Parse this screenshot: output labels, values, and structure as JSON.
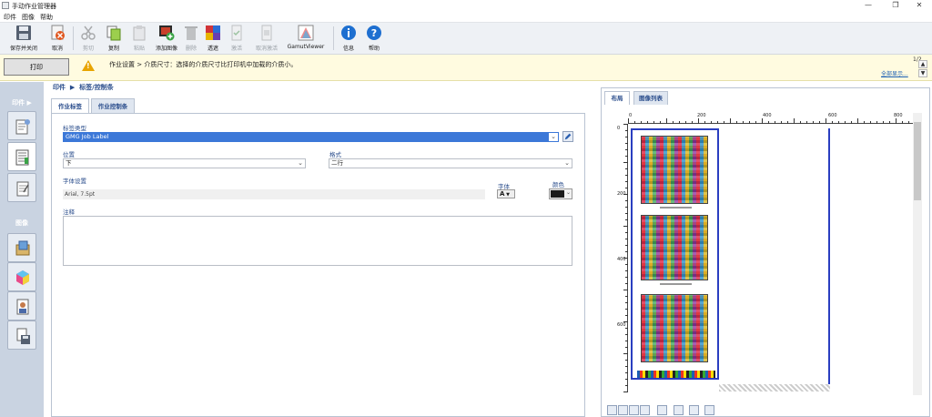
{
  "window": {
    "title": "手动作业管理器",
    "controls": [
      "—",
      "❐",
      "✕"
    ]
  },
  "menu": [
    "印件",
    "图像",
    "帮助"
  ],
  "toolbar": {
    "items": [
      {
        "label": "保存并关闭",
        "icon": "save-icon",
        "disabled": false
      },
      {
        "label": "取消",
        "icon": "cancel-icon",
        "disabled": false
      },
      {
        "label": "剪切",
        "icon": "cut-icon",
        "disabled": true
      },
      {
        "label": "复制",
        "icon": "copy-icon",
        "disabled": false
      },
      {
        "label": "粘贴",
        "icon": "paste-icon",
        "disabled": true
      },
      {
        "label": "添加图像",
        "icon": "add-image-icon",
        "disabled": false
      },
      {
        "label": "删除",
        "icon": "delete-icon",
        "disabled": true
      },
      {
        "label": "透遮",
        "icon": "overlay-icon",
        "disabled": false
      },
      {
        "label": "激活",
        "icon": "activate-icon",
        "disabled": true
      },
      {
        "label": "取消激活",
        "icon": "deactivate-icon",
        "disabled": true
      },
      {
        "label": "GamutViewer",
        "icon": "gamut-viewer-icon",
        "disabled": false
      },
      {
        "label": "信息",
        "icon": "info-icon",
        "disabled": false
      },
      {
        "label": "帮助",
        "icon": "help-icon",
        "disabled": false
      }
    ]
  },
  "warning": {
    "print_label": "打印",
    "text": "作业设置 > 介质尺寸：选择的介质尺寸比打印机中加载的介质小。",
    "page": "1/2",
    "show_all": "全部显示..."
  },
  "sidebar": {
    "section1": "印件",
    "section2": "图像"
  },
  "breadcrumb": {
    "part1": "印件",
    "part2": "标签/控制条"
  },
  "tabs": [
    "作业标签",
    "作业控制条"
  ],
  "form": {
    "label_type": {
      "label": "标签类型",
      "value": "GMG Job Label"
    },
    "position": {
      "label": "位置",
      "value": "下"
    },
    "format": {
      "label": "格式",
      "value": "二行"
    },
    "font_settings": {
      "label": "字体设置",
      "value": "Arial, 7.5pt"
    },
    "font": {
      "label": "字体",
      "value": "A"
    },
    "color": {
      "label": "颜色",
      "value": "#1a1a1a"
    },
    "comment": {
      "label": "注释",
      "value": ""
    }
  },
  "right_panel": {
    "tabs": [
      "布局",
      "图像列表"
    ],
    "ruler_labels": [
      "0",
      "200",
      "400",
      "600",
      "800"
    ],
    "vruler_labels": [
      "0",
      "200",
      "400",
      "600"
    ]
  }
}
